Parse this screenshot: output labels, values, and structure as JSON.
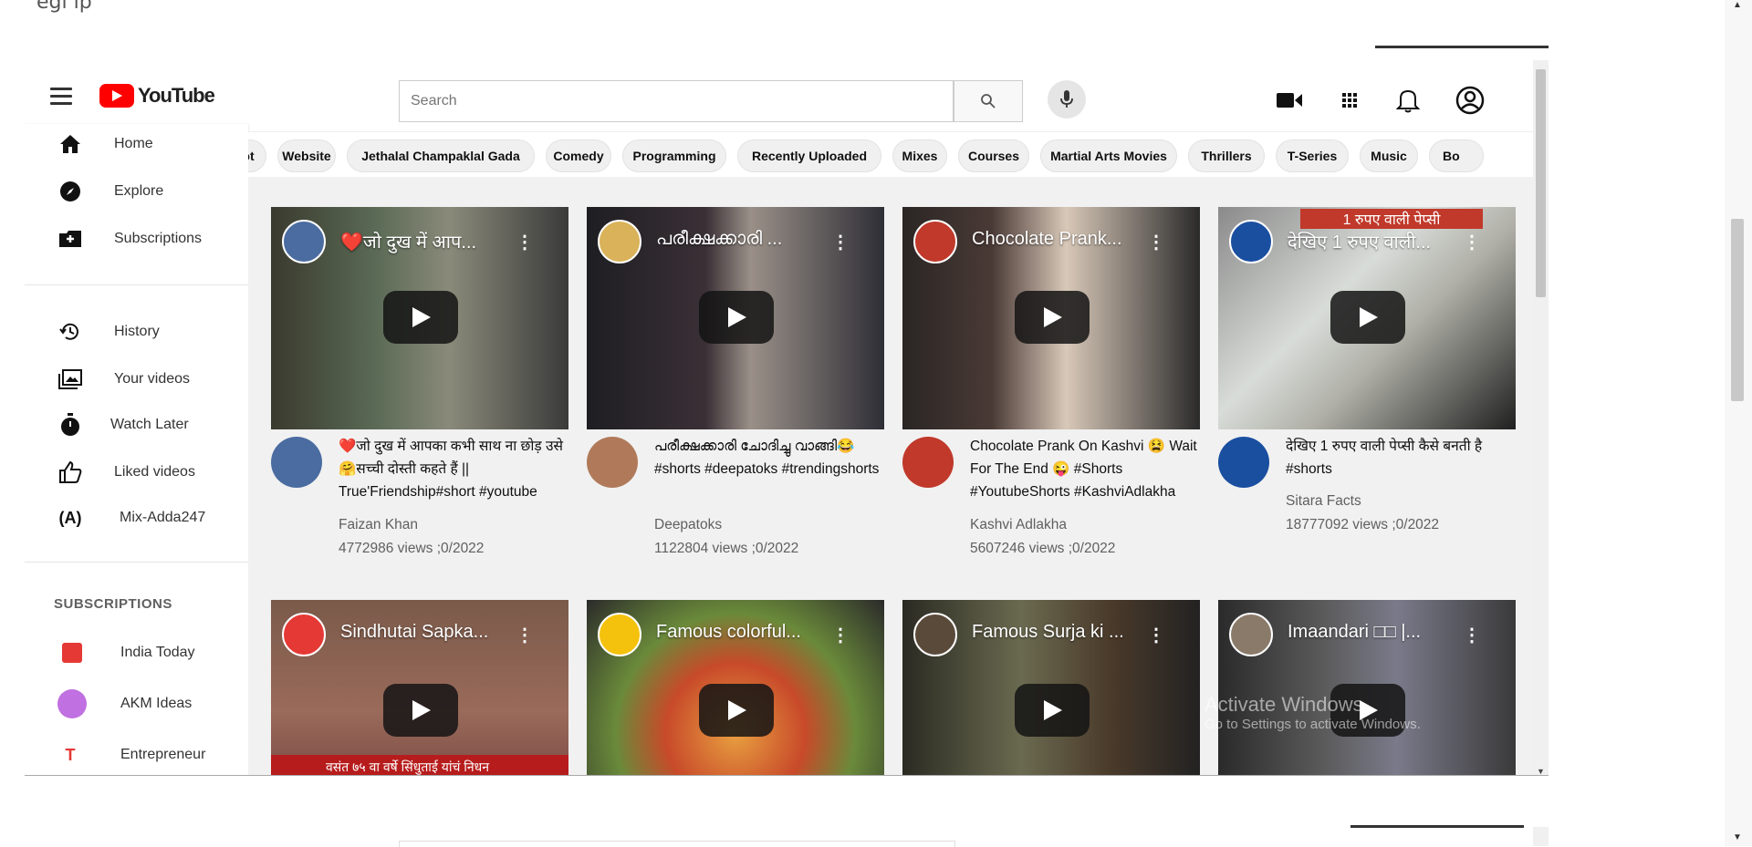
{
  "clipped_text": "egi        ip",
  "header": {
    "logo_text": "YouTube",
    "search_placeholder": "Search"
  },
  "sidebar": {
    "items": [
      {
        "label": "Home",
        "icon": "home-icon"
      },
      {
        "label": "Explore",
        "icon": "compass-icon"
      },
      {
        "label": "Subscriptions",
        "icon": "subscriptions-icon"
      },
      {
        "label": "History",
        "icon": "history-icon"
      },
      {
        "label": "Your videos",
        "icon": "your-videos-icon"
      },
      {
        "label": "Watch Later",
        "icon": "watch-later-icon"
      },
      {
        "label": "Liked videos",
        "icon": "thumbs-up-icon"
      },
      {
        "label": "Mix-Adda247",
        "icon": "broadcast-icon"
      }
    ],
    "subscriptions_heading": "SUBSCRIPTIONS",
    "subscriptions": [
      {
        "label": "India Today",
        "color": "#e53935"
      },
      {
        "label": "AKM Ideas",
        "color": "#c070e0"
      },
      {
        "label": "Entrepreneur",
        "color": "#e53935"
      }
    ]
  },
  "chips": [
    "ot",
    "Website",
    "Jethalal Champaklal Gada",
    "Comedy",
    "Programming",
    "Recently Uploaded",
    "Mixes",
    "Courses",
    "Martial Arts Movies",
    "Thrillers",
    "T-Series",
    "Music",
    "Bo"
  ],
  "videos": [
    {
      "thumb_title": "❤️जो दुख में आप...",
      "title": "❤️जो दुख में आपका कभी साथ ना छोड़ उसे 🤗सच्ची दोस्ती कहते हैं || True'Friendship#short #youtube",
      "channel": "Faizan Khan",
      "views": "4772986 views ;0/2022"
    },
    {
      "thumb_title": "പരീക്ഷക്കാരി ...",
      "title": "പരീക്ഷക്കാരി ചോദിച്ചു വാങ്ങി😂 #shorts #deepatoks #trendingshorts",
      "channel": "Deepatoks",
      "views": "1122804 views ;0/2022"
    },
    {
      "thumb_title": "Chocolate Prank...",
      "title": "Chocolate Prank On Kashvi 😫 Wait For The End 😜 #Shorts #YoutubeShorts #KashviAdlakha",
      "channel": "Kashvi Adlakha",
      "views": "5607246 views ;0/2022"
    },
    {
      "thumb_title": "देखिए 1 रुपए वाली...",
      "title": "देखिए 1 रुपए वाली पेप्सी कैसे बनती है #shorts",
      "channel": "Sitara Facts",
      "views": "18777092 views ;0/2022"
    },
    {
      "thumb_title": "Sindhutai Sapka..."
    },
    {
      "thumb_title": "Famous colorful..."
    },
    {
      "thumb_title": "Famous Surja ki ..."
    },
    {
      "thumb_title": "Imaandari □□ |..."
    }
  ],
  "thumb_texts": {
    "pepsi_overlay": "1 रुपए वाली पेप्सी",
    "news_banner": "वसंत ७५ वा वर्षे सिंधुताई यांचं निधन"
  },
  "watermark": {
    "line1": "Activate Windows",
    "line2": "Go to Settings to activate Windows."
  },
  "colors": {
    "brand_red": "#ff0000",
    "chip_bg": "#f0f0f0",
    "content_bg": "#f1f1f1"
  }
}
